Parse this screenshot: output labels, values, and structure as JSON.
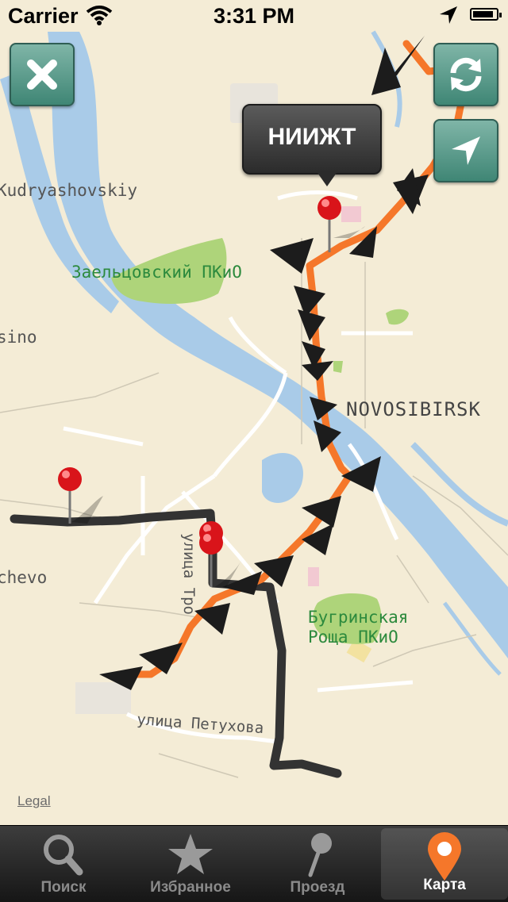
{
  "status_bar": {
    "carrier": "Carrier",
    "time": "3:31 PM",
    "battery_level": 0.9,
    "wifi_icon": "wifi-icon",
    "location_icon": "location-arrow-icon"
  },
  "map": {
    "labels": {
      "kudryashovskiy": "Kudryashovskiy",
      "zaeltsovsky": "Заельцовский ПКиО",
      "sino": "sino",
      "novosibirsk": "NOVOSIBIRSK",
      "chevo": "chevo",
      "ulitsa_tro": "улица Тро",
      "bugrinskaya_1": "Бугринская",
      "bugrinskaya_2": "Роща ПКиО",
      "petukhova": "улица Петухова"
    },
    "callout": "НИИЖТ",
    "legal": "Legal",
    "colors": {
      "land": "#f4ecd6",
      "water": "#a9cbe8",
      "park": "#aed47a",
      "route_orange": "#f5772a",
      "route_dark": "#333333",
      "pin": "#d9141a"
    }
  },
  "buttons": {
    "close_icon": "close-icon",
    "refresh_icon": "refresh-icon",
    "locate_icon": "locate-arrow-icon"
  },
  "tabs": [
    {
      "label": "Поиск",
      "icon": "search-icon",
      "active": false
    },
    {
      "label": "Избранное",
      "icon": "star-icon",
      "active": false
    },
    {
      "label": "Проезд",
      "icon": "pin-icon",
      "active": false
    },
    {
      "label": "Карта",
      "icon": "map-pin-icon",
      "active": true
    }
  ]
}
